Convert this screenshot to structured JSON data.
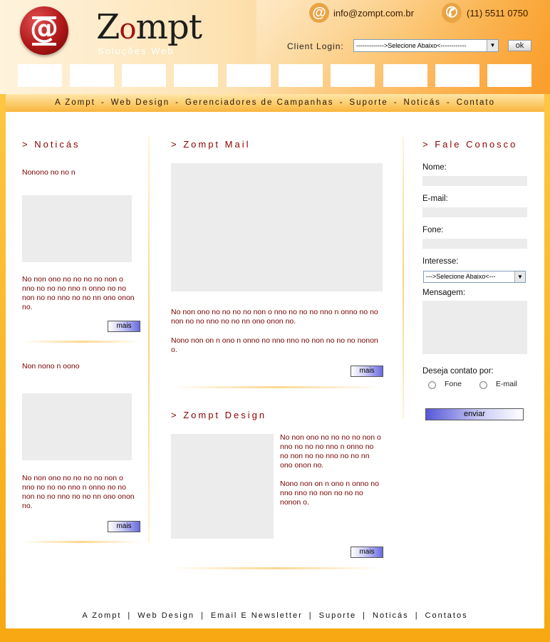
{
  "header": {
    "logo_icon": "at-sign-logo",
    "brand_z": "Z",
    "brand_o": "o",
    "brand_rest": "mpt",
    "tagline": "Soluções Web",
    "email": "info@zompt.com.br",
    "phone": "(11) 5511 0750",
    "login_label": "Client Login:",
    "login_select_value": "------------->Selecione Abaixo<------------",
    "ok_label": "ok"
  },
  "nav": {
    "items": [
      "A Zompt",
      "Web Design",
      "Gerenciadores de Campanhas",
      "Suporte",
      "Noticás",
      "Contato"
    ],
    "separator": "-"
  },
  "left": {
    "title": "> Noticás",
    "news": [
      {
        "headline": "Nonono no no n",
        "body": "No non ono no no no no non o nno no no no nno n onno no no non no no nno no no nn ono onon no.",
        "button": "mais"
      },
      {
        "headline": "Non nono n oono",
        "body": "No non ono no no no no non o nno no no no nno n onno no no non no no nno no no nn ono onon no.",
        "button": "mais"
      }
    ]
  },
  "center": {
    "mail_title": "> Zompt Mail",
    "mail_body_1": "No non ono no no no no non o nno no no no nno n onno no no non no no nno no no nn ono onon no.",
    "mail_body_2": "Nono non on n ono n onno no nno nno no non no no no nonon o.",
    "mail_button": "mais",
    "design_title": "> Zompt Design",
    "design_body_1": "No non ono no no no no non o nno no no no nno n onno no no non no no nno no no nn ono onon no.",
    "design_body_2": "Nono non on n ono n onno no nno nno no non no no no nonon o.",
    "design_button": "mais"
  },
  "right": {
    "title": "> Fale Conosco",
    "name_label": "Nome:",
    "email_label": "E-mail:",
    "phone_label": "Fone:",
    "interest_label": "Interesse:",
    "interest_select_value": "--->Selecione Abaixo<---",
    "message_label": "Mensagem:",
    "contact_pref_label": "Deseja contato por:",
    "radio_phone": "Fone",
    "radio_email": "E-mail",
    "send_button": "enviar"
  },
  "footer": {
    "items": [
      "A Zompt",
      "Web Design",
      "Email E Newsletter",
      "Suporte",
      "Noticás",
      "Contatos"
    ],
    "separator": "|"
  },
  "colors": {
    "accent_red": "#8a0000",
    "brand_orange": "#f9a83a",
    "page_yellow": "#fbb31c"
  }
}
